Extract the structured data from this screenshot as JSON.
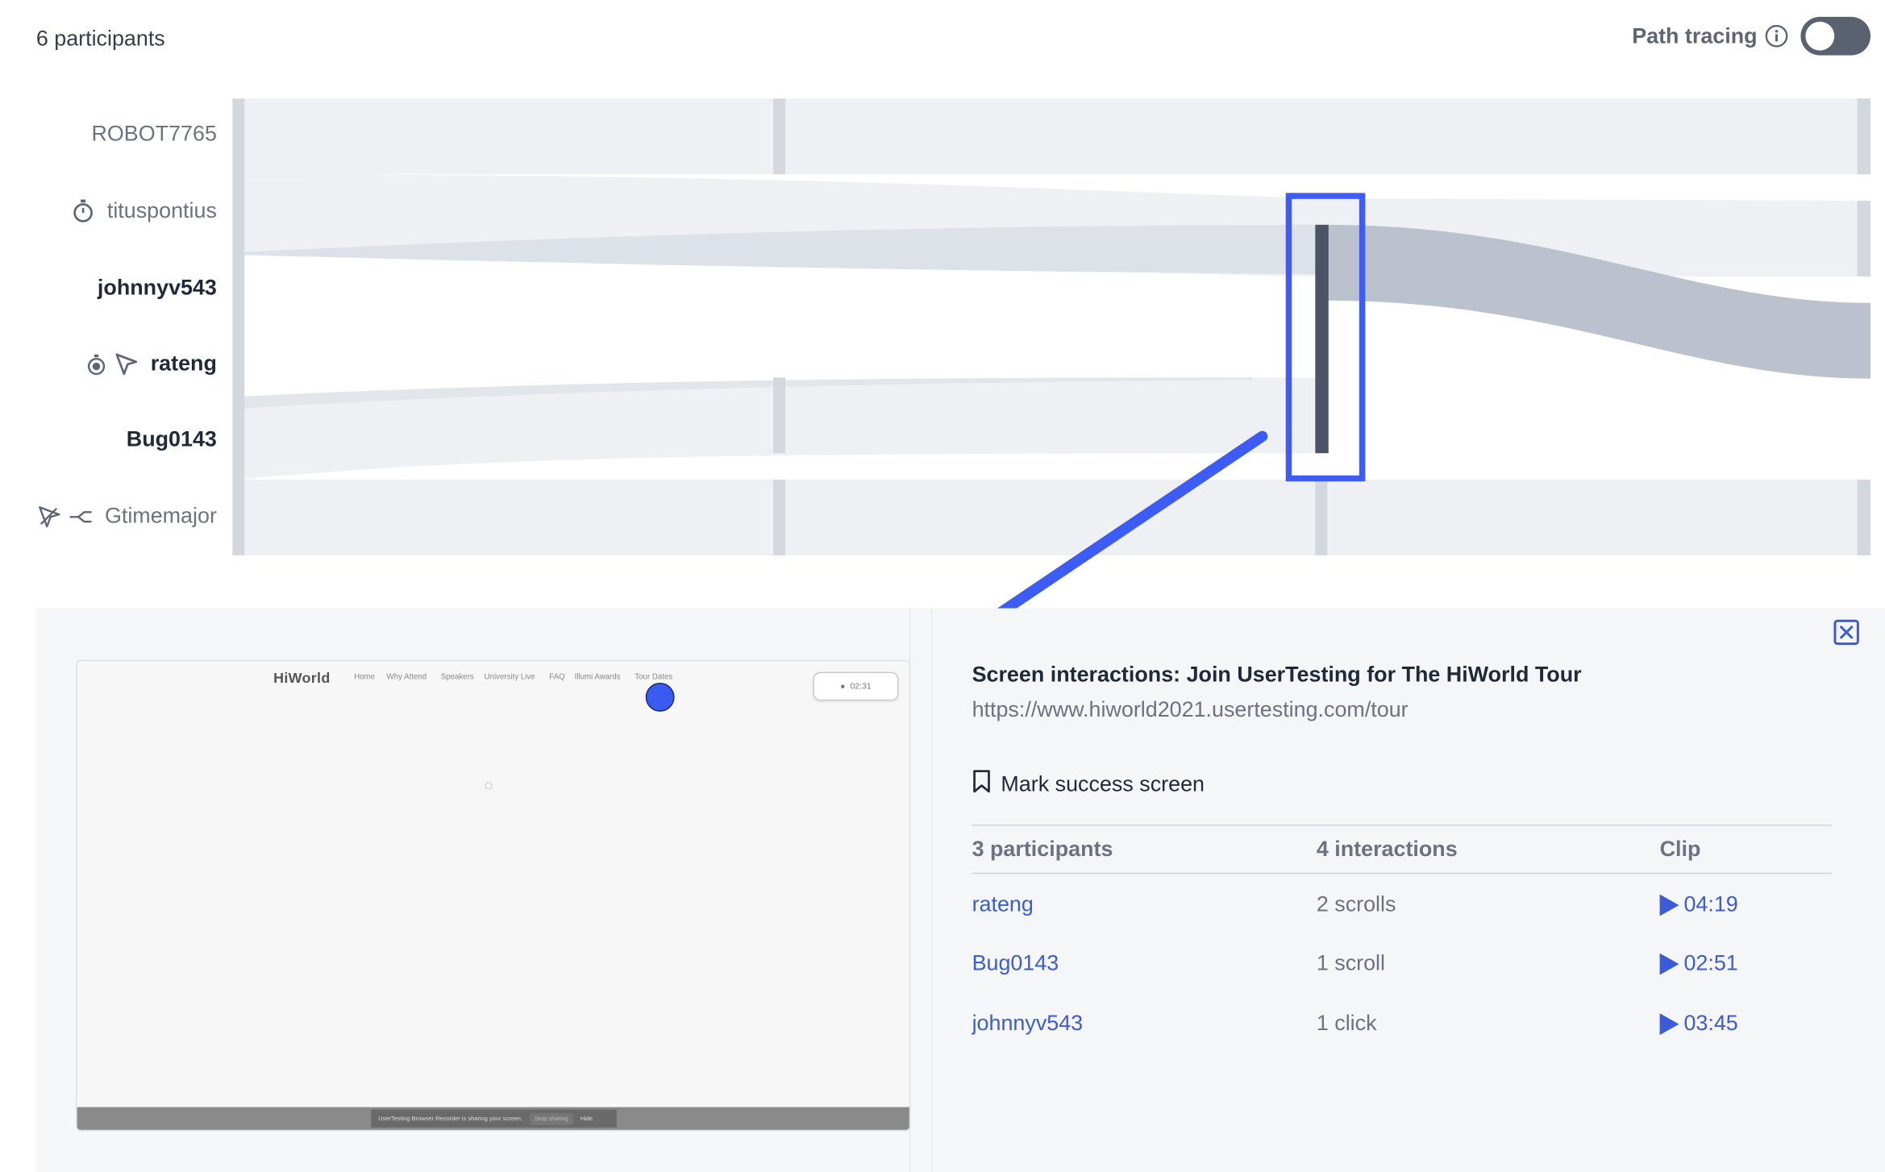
{
  "header": {
    "participants_count": "6 participants",
    "path_tracing_label": "Path tracing",
    "path_tracing_enabled": false
  },
  "participants": [
    {
      "name": "ROBOT7765",
      "emphasis": "dim",
      "icons": []
    },
    {
      "name": "tituspontius",
      "emphasis": "dim",
      "icons": [
        "stopwatch-icon"
      ]
    },
    {
      "name": "johnnyv543",
      "emphasis": "bold",
      "icons": []
    },
    {
      "name": "rateng",
      "emphasis": "bold",
      "icons": [
        "stopwatch-icon",
        "cursor-arrow-icon"
      ]
    },
    {
      "name": "Bug0143",
      "emphasis": "bold",
      "icons": []
    },
    {
      "name": "Gtimemajor",
      "emphasis": "dim",
      "icons": [
        "misclick-icon",
        "path-branch-icon"
      ]
    }
  ],
  "screenshot_preview": {
    "site_logo": "HiWorld",
    "site_nav": [
      "Home",
      "Why Attend",
      "Speakers",
      "University Live",
      "FAQ",
      "Illumi Awards",
      "Tour Dates"
    ],
    "timer": "02:31",
    "recorder_message": "UserTesting Browser Recorder is sharing your screen.",
    "recorder_stop": "Stop sharing",
    "recorder_hide": "Hide"
  },
  "detail": {
    "title": "Screen interactions: Join UserTesting for The HiWorld Tour",
    "url": "https://www.hiworld2021.usertesting.com/tour",
    "mark_success_label": "Mark success screen",
    "table": {
      "headers": [
        "3 participants",
        "4 interactions",
        "Clip"
      ],
      "rows": [
        {
          "participant": "rateng",
          "interactions": "2 scrolls",
          "clip": "04:19"
        },
        {
          "participant": "Bug0143",
          "interactions": "1 scroll",
          "clip": "02:51"
        },
        {
          "participant": "johnnyv543",
          "interactions": "1 click",
          "clip": "03:45"
        }
      ]
    }
  },
  "colors": {
    "accent_blue": "#3b5bdb",
    "highlight_box": "#3d5bf5",
    "flow_light": "#eef0f3",
    "flow_mid": "#dde1e8",
    "flow_dark": "#bcc2cd",
    "node_bar": "#4b5366"
  }
}
